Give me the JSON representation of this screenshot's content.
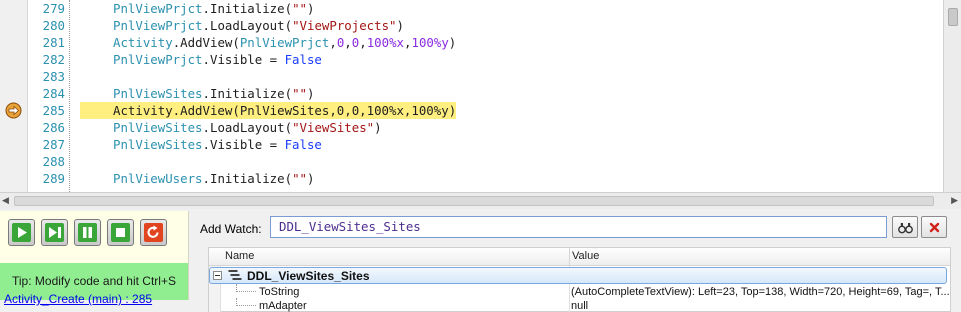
{
  "editor": {
    "lines": [
      {
        "num": "279",
        "tokens": [
          {
            "t": "PnlViewPrjct",
            "c": "obj"
          },
          {
            "t": ".Initialize(",
            "c": "plain"
          },
          {
            "t": "\"\"",
            "c": "str"
          },
          {
            "t": ")",
            "c": "plain"
          }
        ]
      },
      {
        "num": "280",
        "tokens": [
          {
            "t": "PnlViewPrjct",
            "c": "obj"
          },
          {
            "t": ".LoadLayout(",
            "c": "plain"
          },
          {
            "t": "\"ViewProjects\"",
            "c": "str"
          },
          {
            "t": ")",
            "c": "plain"
          }
        ]
      },
      {
        "num": "281",
        "tokens": [
          {
            "t": "Activity",
            "c": "obj"
          },
          {
            "t": ".AddView(",
            "c": "plain"
          },
          {
            "t": "PnlViewPrjct",
            "c": "obj"
          },
          {
            "t": ",",
            "c": "plain"
          },
          {
            "t": "0",
            "c": "num"
          },
          {
            "t": ",",
            "c": "plain"
          },
          {
            "t": "0",
            "c": "num"
          },
          {
            "t": ",",
            "c": "plain"
          },
          {
            "t": "100%x",
            "c": "num"
          },
          {
            "t": ",",
            "c": "plain"
          },
          {
            "t": "100%y",
            "c": "num"
          },
          {
            "t": ")",
            "c": "plain"
          }
        ]
      },
      {
        "num": "282",
        "tokens": [
          {
            "t": "PnlViewPrjct",
            "c": "obj"
          },
          {
            "t": ".Visible = ",
            "c": "plain"
          },
          {
            "t": "False",
            "c": "kw"
          }
        ]
      },
      {
        "num": "283",
        "tokens": []
      },
      {
        "num": "284",
        "tokens": [
          {
            "t": "PnlViewSites",
            "c": "obj"
          },
          {
            "t": ".Initialize(",
            "c": "plain"
          },
          {
            "t": "\"\"",
            "c": "str"
          },
          {
            "t": ")",
            "c": "plain"
          }
        ]
      },
      {
        "num": "285",
        "highlight": true,
        "tokens": [
          {
            "t": "Activity.AddView(PnlViewSites,0,0,100%x,100%y)",
            "c": "plain"
          }
        ]
      },
      {
        "num": "286",
        "tokens": [
          {
            "t": "PnlViewSites",
            "c": "obj"
          },
          {
            "t": ".LoadLayout(",
            "c": "plain"
          },
          {
            "t": "\"ViewSites\"",
            "c": "str"
          },
          {
            "t": ")",
            "c": "plain"
          }
        ]
      },
      {
        "num": "287",
        "tokens": [
          {
            "t": "PnlViewSites",
            "c": "obj"
          },
          {
            "t": ".Visible = ",
            "c": "plain"
          },
          {
            "t": "False",
            "c": "kw"
          }
        ]
      },
      {
        "num": "288",
        "tokens": []
      },
      {
        "num": "289",
        "tokens": [
          {
            "t": "PnlViewUsers",
            "c": "obj"
          },
          {
            "t": ".Initialize(",
            "c": "plain"
          },
          {
            "t": "\"\"",
            "c": "str"
          },
          {
            "t": ")",
            "c": "plain"
          }
        ]
      }
    ],
    "breakpoint_icon": "current-line-arrow-icon"
  },
  "debug": {
    "buttons": [
      {
        "name": "run-button",
        "icon": "play-icon"
      },
      {
        "name": "step-button",
        "icon": "step-forward-icon"
      },
      {
        "name": "pause-button",
        "icon": "pause-icon"
      },
      {
        "name": "stop-button",
        "icon": "stop-icon"
      },
      {
        "name": "restart-button",
        "icon": "restart-icon"
      }
    ],
    "tip": "Tip: Modify code and hit Ctrl+S",
    "stack_link": "Activity_Create (main) : 285"
  },
  "watch": {
    "label": "Add Watch:",
    "input_value": "DDL_ViewSites_Sites",
    "inspect_icon": "binoculars-icon",
    "clear_icon": "close-icon",
    "columns": [
      "Name",
      "Value"
    ],
    "root": {
      "name": "DDL_ViewSites_Sites",
      "value": ""
    },
    "rows": [
      {
        "name": "ToString",
        "value": "(AutoCompleteTextView): Left=23, Top=138, Width=720, Height=69, Tag=, T..."
      },
      {
        "name": "mAdapter",
        "value": "null"
      }
    ]
  },
  "colors": {
    "highlight": "#ffef80",
    "object": "#2b91af",
    "string": "#a31515",
    "number": "#8a2be2",
    "keyword": "#1a3cff",
    "tip_bg": "#90ee90",
    "button_bar_bg": "#ffffe7"
  }
}
